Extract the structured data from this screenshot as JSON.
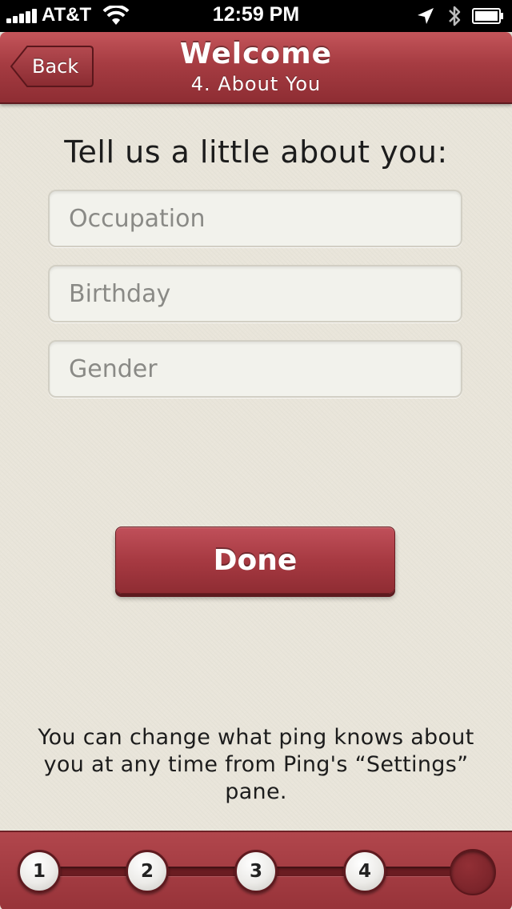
{
  "status_bar": {
    "carrier": "AT&T",
    "time": "12:59 PM",
    "icons": [
      "signal-bars-icon",
      "wifi-icon",
      "location-arrow-icon",
      "bluetooth-icon",
      "battery-icon"
    ]
  },
  "nav": {
    "back_label": "Back",
    "title": "Welcome",
    "subtitle": "4. About You"
  },
  "form": {
    "prompt": "Tell us a little about you:",
    "fields": [
      {
        "placeholder": "Occupation",
        "value": ""
      },
      {
        "placeholder": "Birthday",
        "value": ""
      },
      {
        "placeholder": "Gender",
        "value": ""
      }
    ],
    "done_label": "Done"
  },
  "footnote": "You can change what ping knows about you at any time from Ping's “Settings” pane.",
  "progress": {
    "steps": [
      "1",
      "2",
      "3",
      "4"
    ],
    "current_step": 4
  },
  "colors": {
    "accent": "#a63c42",
    "background": "#e9e5da",
    "field_bg": "#f2f2ec"
  }
}
